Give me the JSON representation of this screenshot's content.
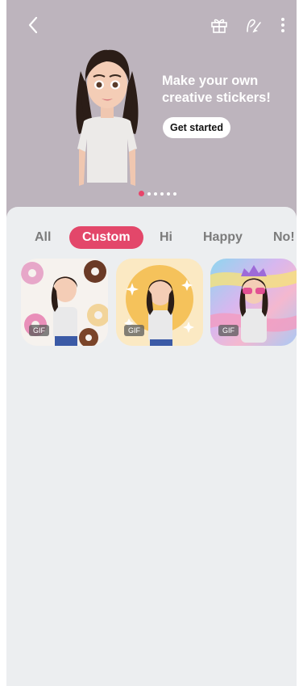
{
  "banner": {
    "headline_line1": "Make your own",
    "headline_line2": "creative stickers!",
    "cta_label": "Get started",
    "background_color": "#bdb4bd",
    "page_count": 6,
    "active_page": 1
  },
  "toolbar": {
    "back_icon": "chevron-left-icon",
    "gift_icon": "gift-icon",
    "draw_icon": "draw-sticker-icon",
    "more_icon": "more-vertical-icon"
  },
  "tabs": [
    {
      "label": "All",
      "active": false
    },
    {
      "label": "Custom",
      "active": true
    },
    {
      "label": "Hi",
      "active": false
    },
    {
      "label": "Happy",
      "active": false
    },
    {
      "label": "No!",
      "active": false
    }
  ],
  "accent_color": "#e3476a",
  "stickers": [
    {
      "badge": "GIF",
      "theme": "donuts"
    },
    {
      "badge": "GIF",
      "theme": "sparkles"
    },
    {
      "badge": "GIF",
      "theme": "rainbow-glasses"
    }
  ]
}
